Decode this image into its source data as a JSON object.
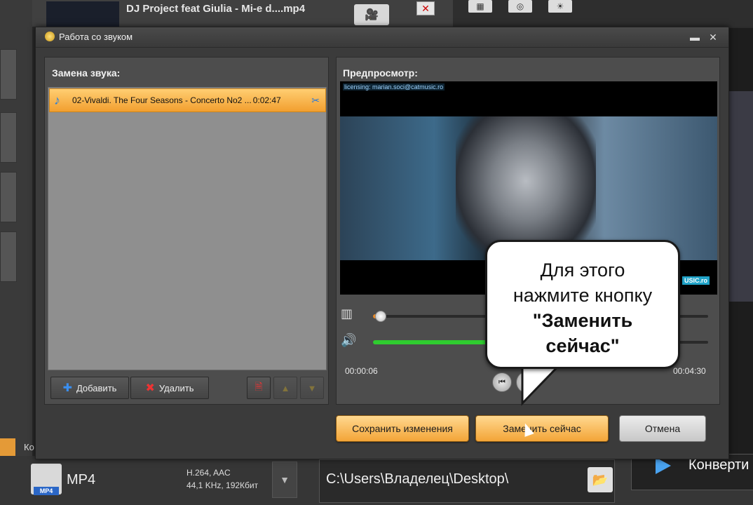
{
  "background": {
    "track_title": "DJ Project feat Giulia - Mi-e d....mp4",
    "format_name": "MP4",
    "format_badge": "MP4",
    "codec_line1": "H.264, AAC",
    "codec_line2": "44,1 KHz, 192Кбит",
    "output_path": "C:\\Users\\Владелец\\Desktop\\",
    "convert_label": "Конверти",
    "ko_label": "Ко",
    "close_glyph": "✕"
  },
  "dialog": {
    "title": "Работа со звуком",
    "minimize_glyph": "▬",
    "close_glyph": "✕",
    "replace_panel": {
      "title": "Замена звука:",
      "items": [
        {
          "name": "02-Vivaldi. The Four Seasons - Concerto No2 ...",
          "duration": "0:02:47"
        }
      ],
      "add_label": "Добавить",
      "delete_label": "Удалить"
    },
    "preview_panel": {
      "title": "Предпросмотр:",
      "licensing_text": "licensing: marian.soci@catmusic.ro",
      "watermark": "USIC.ro",
      "current_time": "00:00:06",
      "total_time": "00:04:30",
      "seek_progress": 0.02,
      "volume_level": 0.5
    },
    "buttons": {
      "save": "Сохранить изменения",
      "replace_now": "Заменить сейчас",
      "cancel": "Отмена"
    }
  },
  "callout": {
    "line1": "Для этого",
    "line2": "нажмите кнопку",
    "line3": "\"Заменить",
    "line4": "сейчас\""
  },
  "colors": {
    "accent_orange": "#f3a537",
    "volume_green": "#2fcc2f",
    "dialog_bg": "#3b3b3b"
  }
}
